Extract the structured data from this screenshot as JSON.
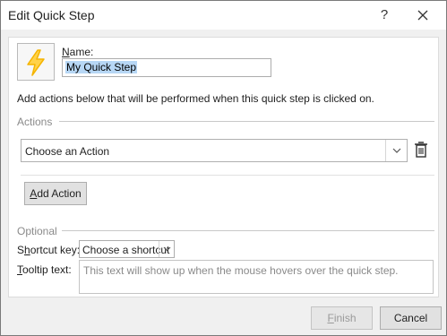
{
  "dialog": {
    "title": "Edit Quick Step",
    "help_label": "?"
  },
  "form": {
    "icon": "lightning-bolt-icon",
    "name_label_underlined": "N",
    "name_label_rest": "ame:",
    "name_value": "My Quick Step",
    "description": "Add actions below that will be performed when this quick step is clicked on.",
    "actions_section": "Actions",
    "action_select_value": "Choose an Action",
    "add_action_underlined": "A",
    "add_action_rest": "dd Action",
    "optional_section": "Optional",
    "shortcut_label_pre": "S",
    "shortcut_label_underlined": "h",
    "shortcut_label_rest": "ortcut key:",
    "shortcut_value": "Choose a shortcut",
    "tooltip_label_underlined": "T",
    "tooltip_label_rest": "ooltip text:",
    "tooltip_placeholder": "This text will show up when the mouse hovers over the quick step."
  },
  "footer": {
    "finish_underlined": "F",
    "finish_rest": "inish",
    "cancel": "Cancel"
  },
  "colors": {
    "accent_bolt": "#f5b400",
    "selection": "#b7d7f5"
  }
}
